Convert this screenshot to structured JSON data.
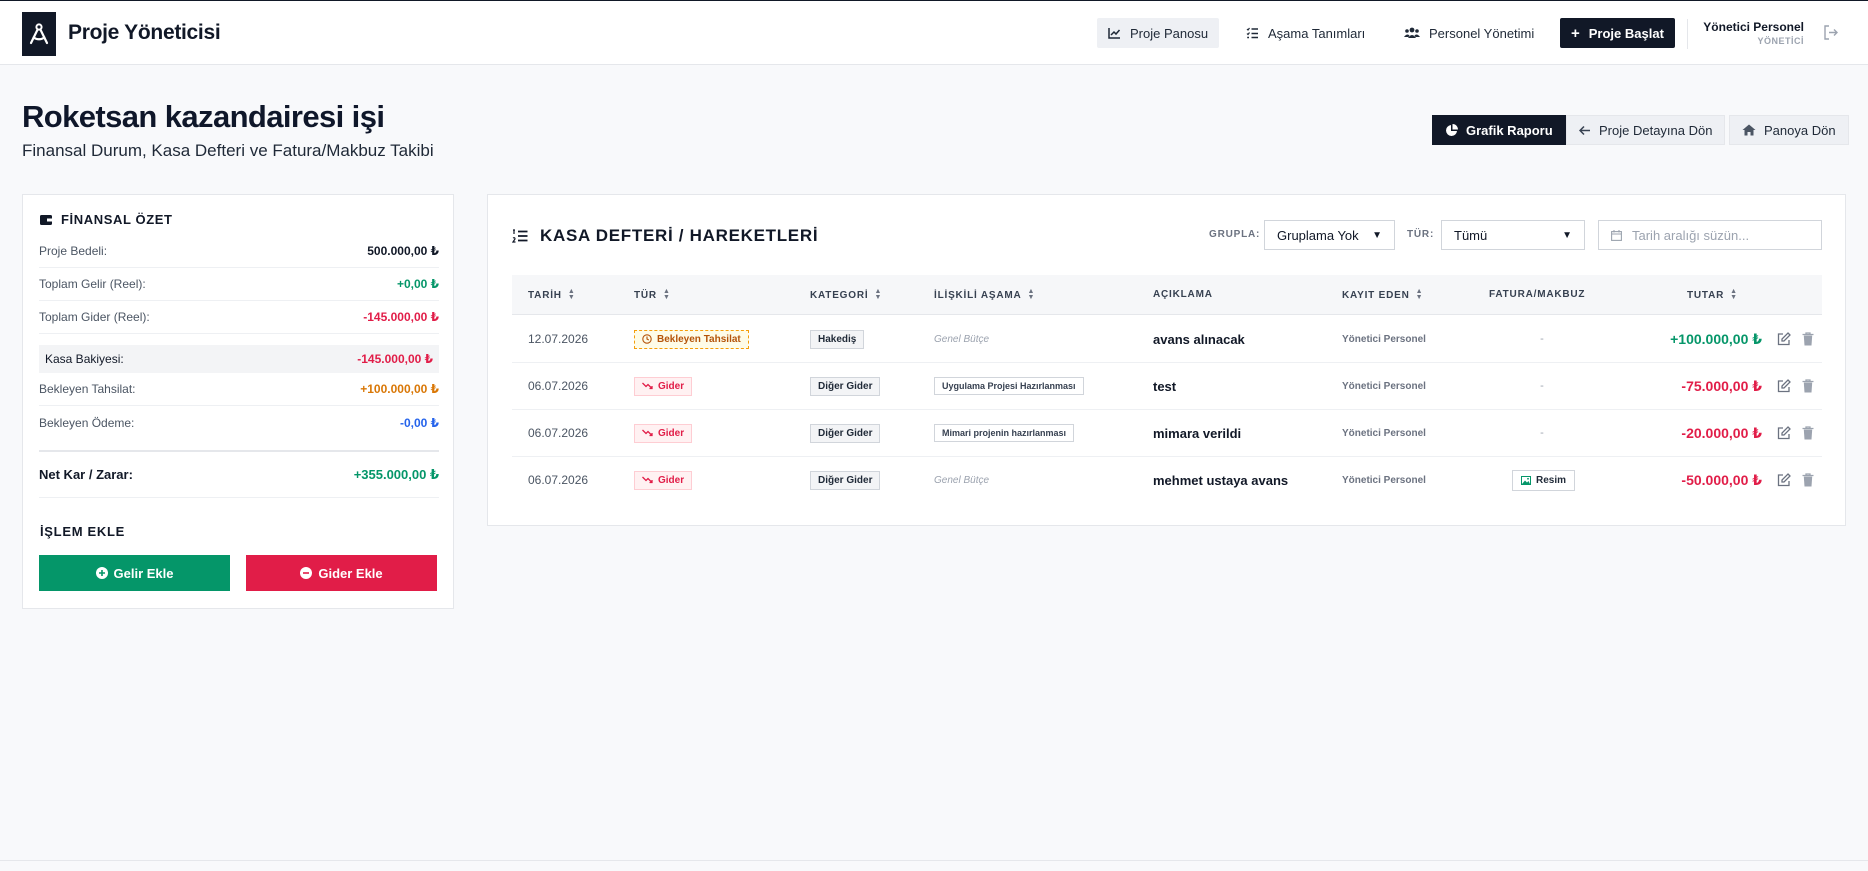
{
  "app": {
    "brand": "Proje Yöneticisi"
  },
  "nav": {
    "items": [
      {
        "label": "Proje Panosu",
        "icon": "chart-line-icon"
      },
      {
        "label": "Aşama Tanımları",
        "icon": "list-check-icon"
      },
      {
        "label": "Personel Yönetimi",
        "icon": "users-icon"
      }
    ],
    "start_label": "Proje Başlat"
  },
  "user": {
    "name": "Yönetici Personel",
    "role": "YÖNETİCİ"
  },
  "page": {
    "title": "Roketsan kazandairesi işi",
    "subtitle": "Finansal Durum, Kasa Defteri ve Fatura/Makbuz Takibi",
    "actions": {
      "report": "Grafik Raporu",
      "back_detail": "Proje Detayına Dön",
      "back_board": "Panoya Dön"
    }
  },
  "finance": {
    "title": "FİNANSAL ÖZET",
    "rows": [
      {
        "label": "Proje Bedeli:",
        "value": "500.000,00 ₺",
        "color": "#111827"
      },
      {
        "label": "Toplam Gelir (Reel):",
        "value": "+0,00 ₺",
        "color": "#059669"
      },
      {
        "label": "Toplam Gider (Reel):",
        "value": "-145.000,00 ₺",
        "color": "#e11d48"
      },
      {
        "label": "Kasa Bakiyesi:",
        "value": "-145.000,00 ₺",
        "color": "#e11d48"
      },
      {
        "label": "Bekleyen Tahsilat:",
        "value": "+100.000,00 ₺",
        "color": "#d97706"
      },
      {
        "label": "Bekleyen Ödeme:",
        "value": "-0,00 ₺",
        "color": "#2563eb"
      }
    ],
    "net": {
      "label": "Net Kar / Zarar:",
      "value": "+355.000,00 ₺",
      "color": "#059669"
    },
    "add_title": "İŞLEM EKLE",
    "add_income": "Gelir Ekle",
    "add_expense": "Gider Ekle"
  },
  "ledger": {
    "title": "KASA DEFTERİ / HAREKETLERİ",
    "group_label": "GRUPLA:",
    "group_value": "Gruplama Yok",
    "type_label": "TÜR:",
    "type_value": "Tümü",
    "date_placeholder": "Tarih aralığı süzün...",
    "columns": [
      "TARİH",
      "TÜR",
      "KATEGORİ",
      "İLİŞKİLİ AŞAMA",
      "AÇIKLAMA",
      "KAYIT EDEN",
      "FATURA/MAKBUZ",
      "TUTAR"
    ],
    "rows": [
      {
        "date": "12.07.2026",
        "type": "Bekleyen Tahsilat",
        "type_kind": "wait",
        "category": "Hakediş",
        "stage": "Genel Bütçe",
        "stage_none": true,
        "desc": "avans alınacak",
        "by": "Yönetici Personel",
        "receipt": "-",
        "amount": "+100.000,00 ₺",
        "amount_color": "#059669"
      },
      {
        "date": "06.07.2026",
        "type": "Gider",
        "type_kind": "gider",
        "category": "Diğer Gider",
        "stage": "Uygulama Projesi Hazırlanması",
        "stage_none": false,
        "desc": "test",
        "by": "Yönetici Personel",
        "receipt": "-",
        "amount": "-75.000,00 ₺",
        "amount_color": "#e11d48"
      },
      {
        "date": "06.07.2026",
        "type": "Gider",
        "type_kind": "gider",
        "category": "Diğer Gider",
        "stage": "Mimari projenin hazırlanması",
        "stage_none": false,
        "desc": "mimara verildi",
        "by": "Yönetici Personel",
        "receipt": "-",
        "amount": "-20.000,00 ₺",
        "amount_color": "#e11d48"
      },
      {
        "date": "06.07.2026",
        "type": "Gider",
        "type_kind": "gider",
        "category": "Diğer Gider",
        "stage": "Genel Bütçe",
        "stage_none": true,
        "desc": "mehmet ustaya avans",
        "by": "Yönetici Personel",
        "receipt": "Resim",
        "amount": "-50.000,00 ₺",
        "amount_color": "#e11d48"
      }
    ]
  }
}
